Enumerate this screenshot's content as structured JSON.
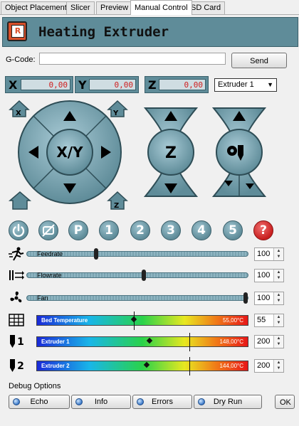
{
  "tabs": [
    "Object Placement",
    "Slicer",
    "Preview",
    "Manual Control",
    "SD Card"
  ],
  "active_tab": "Manual Control",
  "header": {
    "title": "Heating Extruder",
    "logo": "R"
  },
  "gcode": {
    "label": "G-Code:",
    "value": "",
    "send_label": "Send"
  },
  "coords": [
    {
      "axis": "X",
      "value": "0,00"
    },
    {
      "axis": "Y",
      "value": "0,00"
    },
    {
      "axis": "Z",
      "value": "0,00"
    }
  ],
  "extruder_select": "Extruder 1",
  "jog": {
    "xy_label": "X/Y",
    "z_label": "Z",
    "home_x": "X",
    "home_y": "Y",
    "home_z": "Z"
  },
  "quick_buttons": [
    "power-icon",
    "no-motor-icon",
    "P",
    "1",
    "2",
    "3",
    "4",
    "5",
    "?"
  ],
  "quick_labels": {
    "p": "P",
    "b1": "1",
    "b2": "2",
    "b3": "3",
    "b4": "4",
    "b5": "5",
    "help": "?"
  },
  "sliders": [
    {
      "name": "feedrate",
      "label": "Feedrate",
      "value": "100",
      "level": 0.31
    },
    {
      "name": "flowrate",
      "label": "Flowrate",
      "value": "100",
      "level": 0.53
    },
    {
      "name": "fan",
      "label": "Fan",
      "value": "100",
      "level": 1.0
    }
  ],
  "temps": [
    {
      "name": "bed",
      "label": "Bed Temperature",
      "current": "55,00°C",
      "target": "55",
      "icon": "bed-icon"
    },
    {
      "name": "extruder-1",
      "label": "Extruder 1",
      "current": "148,00°C",
      "target": "200",
      "icon": "extruder-1-icon",
      "num": "1"
    },
    {
      "name": "extruder-2",
      "label": "Extruder 2",
      "current": "144,00°C",
      "target": "200",
      "icon": "extruder-2-icon",
      "num": "2"
    }
  ],
  "debug": {
    "label": "Debug Options",
    "buttons": [
      "Echo",
      "Info",
      "Errors",
      "Dry Run"
    ],
    "ok_label": "OK"
  },
  "colors": {
    "accent": "#5f8c99",
    "dark": "#3a5f6a",
    "value_text": "#d12020"
  }
}
